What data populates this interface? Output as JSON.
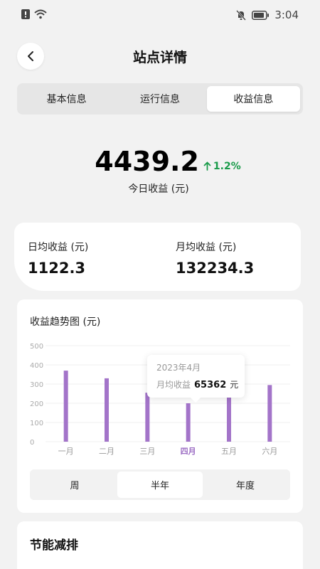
{
  "status": {
    "time": "3:04",
    "icons": [
      "alert-icon",
      "wifi-icon",
      "bell-off-icon",
      "battery-icon"
    ]
  },
  "header": {
    "title": "站点详情",
    "back_icon": "chevron-left-icon"
  },
  "tabs": [
    {
      "label": "基本信息",
      "active": false
    },
    {
      "label": "运行信息",
      "active": false
    },
    {
      "label": "收益信息",
      "active": true
    }
  ],
  "hero": {
    "value": "4439.2",
    "change": "1.2%",
    "change_direction": "up",
    "label": "今日收益 (元)"
  },
  "stats": [
    {
      "label": "日均收益 (元)",
      "value": "1122.3"
    },
    {
      "label": "月均收益 (元)",
      "value": "132234.3"
    }
  ],
  "chart_card": {
    "title": "收益趋势图 (元)",
    "tooltip": {
      "date": "2023年4月",
      "label": "月均收益",
      "value": "65362",
      "unit": "元"
    },
    "range_tabs": [
      {
        "label": "周",
        "active": false
      },
      {
        "label": "半年",
        "active": true
      },
      {
        "label": "年度",
        "active": false
      }
    ]
  },
  "chart_data": {
    "type": "bar",
    "categories": [
      "一月",
      "二月",
      "三月",
      "四月",
      "五月",
      "六月"
    ],
    "values": [
      370,
      330,
      255,
      200,
      240,
      295
    ],
    "highlighted": "四月",
    "ylim": [
      0,
      500
    ],
    "yticks": [
      0,
      100,
      200,
      300,
      400,
      500
    ],
    "grid": true,
    "bar_color": "#a374c9",
    "highlight_label_color": "#9b6cc3"
  },
  "bottom_card": {
    "title": "节能减排"
  },
  "colors": {
    "accent": "#a374c9",
    "positive": "#1a9b4a",
    "background": "#f2f2f2"
  }
}
